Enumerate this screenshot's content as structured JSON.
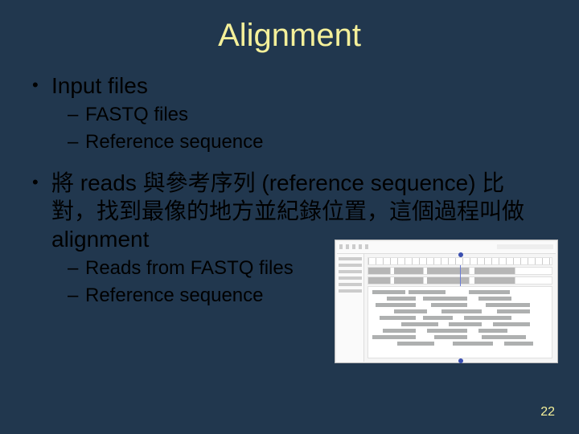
{
  "slide": {
    "title": "Alignment",
    "page_number": "22",
    "bullets": [
      {
        "text": "Input files",
        "sub": [
          "FASTQ files",
          "Reference sequence"
        ]
      },
      {
        "text": "將 reads 與參考序列 (reference sequence) 比對，找到最像的地方並紀錄位置，這個過程叫做 alignment",
        "sub": [
          "Reads from FASTQ files",
          "Reference sequence"
        ]
      }
    ],
    "figure": {
      "alt": "genome-browser-screenshot"
    }
  }
}
